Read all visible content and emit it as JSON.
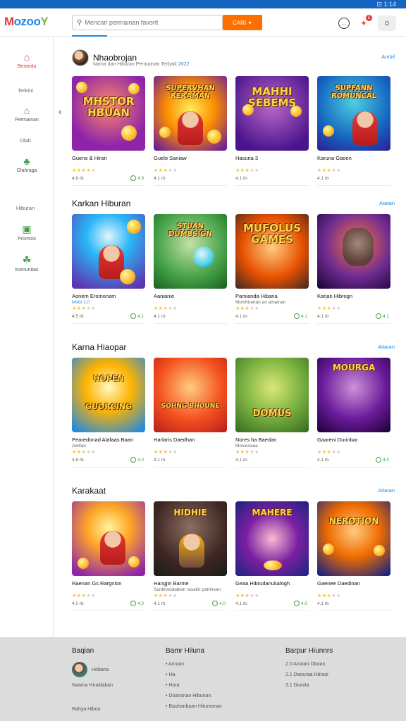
{
  "topbar": {
    "right_text": "⊡ 1:14"
  },
  "header": {
    "logo": {
      "p1": "M",
      "p2": "ozoo",
      "p3": "Y"
    },
    "search_placeholder": "Mencari permainan favorit",
    "search_button": "CARI ✦",
    "icons": [
      "chat-icon",
      "notification-icon",
      "user-icon"
    ],
    "notif_count": "5"
  },
  "sidebar": {
    "items": [
      {
        "name": "home",
        "label": "Beranda",
        "icon": "⌂"
      },
      {
        "name": "games",
        "label": "Permainan",
        "icon": "⌂"
      },
      {
        "name": "sports",
        "label": "Olahraga",
        "icon": "♣"
      },
      {
        "name": "events",
        "label": "Promosi",
        "icon": "▣"
      },
      {
        "name": "community",
        "label": "Komunitas",
        "icon": "☘"
      }
    ],
    "headings": [
      "Terkini",
      "Olah",
      "Hiburan"
    ]
  },
  "profile": {
    "name": "Nhaobrojan",
    "sub1": "Nama dan Hiburan Permainan Terbaik",
    "sub2": "2022"
  },
  "sections": [
    {
      "title": "",
      "link": "Ambil",
      "cards": [
        {
          "thumb_text": "MHSTOR HBUAN",
          "name": "Gueno & Hiran",
          "sub": "",
          "stars": 4,
          "meta": "4.6 rb",
          "badge": "4.9"
        },
        {
          "thumb_text": "SUPERVHAN RERAMAN",
          "name": "Guelo Saniaw",
          "sub": "",
          "stars": 3,
          "meta": "4.1 rb",
          "badge": ""
        },
        {
          "thumb_text": "MAHHI SEBEMS",
          "name": "Hasuna 3",
          "sub": "",
          "stars": 3,
          "meta": "4.1 rb",
          "badge": ""
        },
        {
          "thumb_text": "SUPFANN ROMUNCAL",
          "name": "Karuna Gaoen",
          "sub": "",
          "stars": 3,
          "meta": "4.1 rb",
          "badge": ""
        }
      ]
    },
    {
      "title": "Karkan Hiburan",
      "link": "Ataran",
      "cards": [
        {
          "thumb_text": "",
          "name": "Aonem Eromonam",
          "sub": "Mobi 1.0",
          "stars": 3,
          "meta": "4.5 rb",
          "badge": "4.1"
        },
        {
          "thumb_text": "STUAN DUMBSIGN",
          "name": "Aanianie",
          "sub": "",
          "stars": 3,
          "meta": "4.1 rb",
          "badge": ""
        },
        {
          "thumb_text": "MUFOLUS GAMES",
          "name": "Pamianda Hibana",
          "sub": "Monihiranan an amainan",
          "stars": 3,
          "meta": "4.1 rb",
          "badge": "4.1"
        },
        {
          "thumb_text": "",
          "name": "Karjan Hibrogn",
          "sub": "",
          "stars": 3,
          "meta": "4.1 rb",
          "badge": "4.1"
        }
      ]
    },
    {
      "title": "Karna Hiaopar",
      "link": "Aitaran",
      "cards": [
        {
          "thumb_text": "HOPEN GUORCING",
          "name": "Pearedonad Alafaas Baan",
          "sub": "Aktifan",
          "stars": 3,
          "meta": "4.6 rb",
          "badge": "4.0"
        },
        {
          "thumb_text": "SOHNG BHOUNE",
          "name": "Harlaris Daedhan",
          "sub": "",
          "stars": 3,
          "meta": "4.1 rb",
          "badge": ""
        },
        {
          "thumb_text": "DOMUS",
          "name": "Nores ha Baedan",
          "sub": "Mosienaaa",
          "stars": 3,
          "meta": "4.1 rb",
          "badge": ""
        },
        {
          "thumb_text": "MOURGA",
          "name": "Gaareni Durinbar",
          "sub": "",
          "stars": 3,
          "meta": "4.1 rb",
          "badge": "4.0"
        }
      ]
    },
    {
      "title": "Karakaat",
      "link": "Aitaran",
      "cards": [
        {
          "thumb_text": "",
          "name": "Raenan Gs Rargnion",
          "sub": "",
          "stars": 3,
          "meta": "4.0 rb",
          "badge": "4.0"
        },
        {
          "thumb_text": "HIDHIE",
          "name": "Hangjin Barme",
          "sub": "Sunbrwodatkan rasatin patrinsan",
          "stars": 3,
          "meta": "4.1 rb",
          "badge": "4.0"
        },
        {
          "thumb_text": "MAHERE",
          "name": "Geaa Hibrudanukalogh",
          "sub": "",
          "stars": 3,
          "meta": "4.1 rb",
          "badge": "4.0"
        },
        {
          "thumb_text": "NEROTION",
          "name": "Gaenee Daedinan",
          "sub": "",
          "stars": 3,
          "meta": "4.1 rb",
          "badge": ""
        }
      ]
    }
  ],
  "footer": {
    "col1": {
      "title": "Baqian",
      "name": "Hobana",
      "text": "Naama Hiraidakan",
      "bottom": "Rahya Hibon"
    },
    "col2": {
      "title": "Bamr Hiluna",
      "items": [
        "Amaan",
        "Ha",
        "Hora",
        "Doansnan Hibunan",
        "Bauhanbaan Hitumonan"
      ]
    },
    "col3": {
      "title": "Barpur Hiunnrs",
      "items": [
        "2.0 Amaan Oboan",
        "2.1 Daouraa Hbrasi",
        "3.1 Diunita"
      ]
    }
  }
}
